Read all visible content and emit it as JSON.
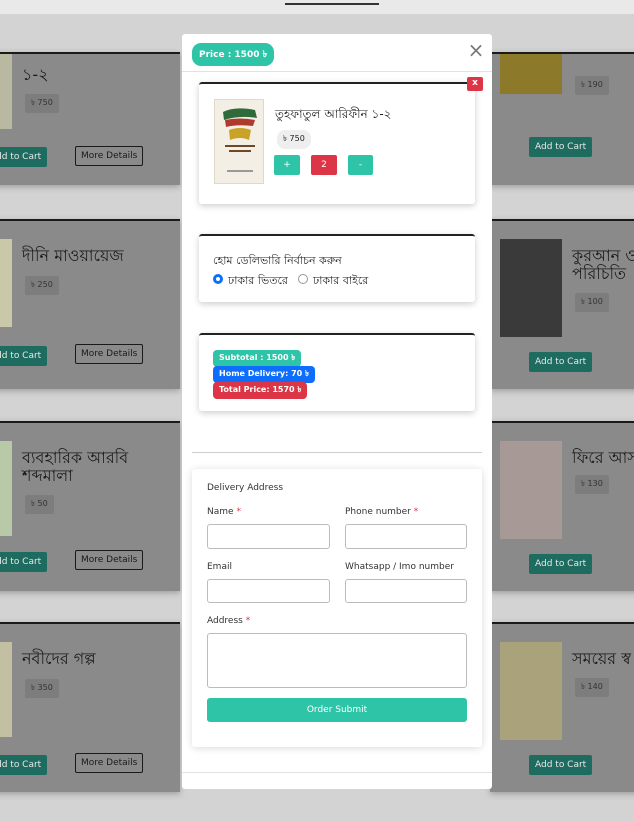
{
  "background": {
    "left_cards": [
      {
        "title": "১-২",
        "price": "৳ 750",
        "cart": "dd to Cart",
        "more": "More Details"
      },
      {
        "title": "দীনি মাওয়ায়েজ",
        "price": "৳ 250",
        "cart": "dd to Cart",
        "more": "More Details"
      },
      {
        "title": "ব্যবহারিক আরবি শব্দমালা",
        "price": "৳ 50",
        "cart": "dd to Cart",
        "more": "More Details"
      },
      {
        "title": "নবীদের গল্প",
        "price": "৳ 350",
        "cart": "dd to Cart",
        "more": "More Details"
      }
    ],
    "right_cards": [
      {
        "title": "",
        "price": "৳ 190",
        "cart": "Add to Cart"
      },
      {
        "title": "কুরআন ও পরিচিতি",
        "price": "৳ 100",
        "cart": "Add to Cart"
      },
      {
        "title": "ফিরে আস",
        "price": "৳ 130",
        "cart": "Add to Cart"
      },
      {
        "title": "সময়ের স্ব",
        "price": "৳ 140",
        "cart": "Add to Cart"
      }
    ]
  },
  "modal": {
    "price_badge": "Price : 1500 ৳",
    "close_icon": "×",
    "cart_item": {
      "remove_icon": "x",
      "title": "তুহফাতুল আরিফীন ১-২",
      "price": "৳ 750",
      "plus": "+",
      "quantity": "2",
      "minus": "-"
    },
    "delivery": {
      "title": "হোম ডেলিভারি নির্বাচন করুন",
      "option_inside": "ঢাকার ভিতরে",
      "option_outside": "ঢাকার বাইরে",
      "selected": "inside"
    },
    "summary": {
      "subtotal": "Subtotal : 1500 ৳",
      "delivery": "Home Delivery: 70 ৳",
      "total": "Total Price: 1570 ৳"
    },
    "form": {
      "heading": "Delivery Address",
      "name_label": "Name",
      "phone_label": "Phone number",
      "email_label": "Email",
      "whatsapp_label": "Whatsapp / Imo number",
      "address_label": "Address",
      "required_mark": "*",
      "name_value": "",
      "phone_value": "",
      "email_value": "",
      "whatsapp_value": "",
      "address_value": "",
      "submit": "Order Submit"
    }
  },
  "colors": {
    "accent": "#2ec4a7",
    "danger": "#dc3545",
    "primary": "#0d6efd"
  }
}
